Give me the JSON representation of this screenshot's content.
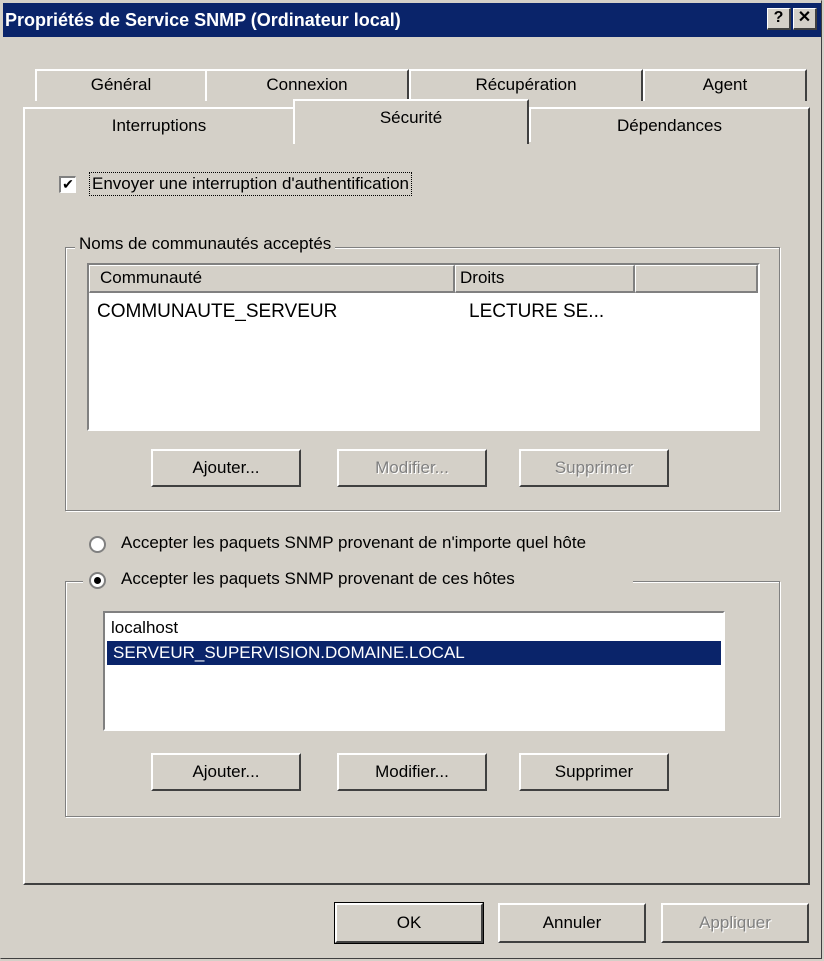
{
  "window": {
    "title": "Propriétés de Service SNMP (Ordinateur local)",
    "help_label": "?",
    "close_label": "✕"
  },
  "tabs_row1": [
    {
      "label": "Général"
    },
    {
      "label": "Connexion"
    },
    {
      "label": "Récupération"
    },
    {
      "label": "Agent"
    }
  ],
  "tabs_row2": [
    {
      "label": "Interruptions"
    },
    {
      "label": "Sécurité",
      "selected": true
    },
    {
      "label": "Dépendances"
    }
  ],
  "security": {
    "send_trap": {
      "label": "Envoyer une interruption d'authentification",
      "checked": true
    },
    "communities": {
      "legend": "Noms de communautés acceptés",
      "columns": [
        "Communauté",
        "Droits"
      ],
      "rows": [
        {
          "community": "COMMUNAUTE_SERVEUR",
          "rights": "LECTURE SE..."
        }
      ],
      "buttons": {
        "add": "Ajouter...",
        "edit": "Modifier...",
        "remove": "Supprimer"
      }
    },
    "accept_any": {
      "label": "Accepter les paquets SNMP provenant de n'importe quel hôte",
      "selected": false
    },
    "accept_hosts": {
      "label": "Accepter les paquets SNMP provenant de ces hôtes",
      "selected": true,
      "hosts": [
        "localhost",
        "SERVEUR_SUPERVISION.DOMAINE.LOCAL"
      ],
      "selected_host": "SERVEUR_SUPERVISION.DOMAINE.LOCAL",
      "buttons": {
        "add": "Ajouter...",
        "edit": "Modifier...",
        "remove": "Supprimer"
      }
    }
  },
  "footer": {
    "ok": "OK",
    "cancel": "Annuler",
    "apply": "Appliquer"
  },
  "colors": {
    "title_bg": "#0a246a",
    "selection": "#0a246a",
    "face": "#d4d0c8"
  }
}
